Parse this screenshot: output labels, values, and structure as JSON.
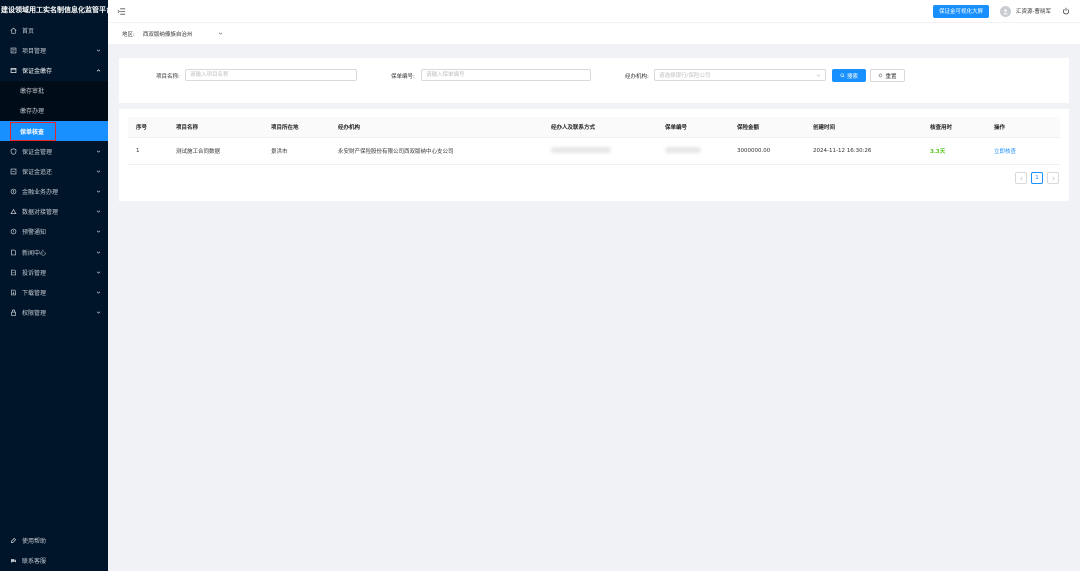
{
  "app": {
    "title": "建设领域用工实名制信息化监管平台"
  },
  "sidebar": {
    "items": [
      {
        "label": "首页",
        "icon": "home-icon"
      },
      {
        "label": "项目管理",
        "icon": "project-icon"
      },
      {
        "label": "保证金缴存",
        "icon": "deposit-icon",
        "open": true
      }
    ],
    "submenu": [
      {
        "label": "缴存审批"
      },
      {
        "label": "缴存办理"
      },
      {
        "label": "保单核查",
        "active": true
      }
    ],
    "items_after": [
      {
        "label": "保证金管理",
        "icon": "shield-icon"
      },
      {
        "label": "保证金追还",
        "icon": "return-icon"
      },
      {
        "label": "金融业务办理",
        "icon": "finance-icon"
      },
      {
        "label": "数据对接管理",
        "icon": "data-icon"
      },
      {
        "label": "预警通知",
        "icon": "alert-icon"
      },
      {
        "label": "新闻中心",
        "icon": "news-icon"
      },
      {
        "label": "投诉管理",
        "icon": "complaint-icon"
      },
      {
        "label": "下载管理",
        "icon": "download-icon"
      },
      {
        "label": "权限管理",
        "icon": "permission-icon"
      }
    ],
    "bottom": [
      {
        "label": "使用帮助",
        "icon": "help-icon"
      },
      {
        "label": "联系客服",
        "icon": "service-icon"
      }
    ]
  },
  "header": {
    "bigscreen_label": "保证金可视化大屏",
    "username": "汇资源-曹晓军"
  },
  "region": {
    "label": "地区:",
    "value": "西双版纳傣族自治州"
  },
  "search": {
    "project_label": "项目名称:",
    "project_placeholder": "请输入项目名称",
    "policy_label": "保单编号:",
    "policy_placeholder": "请输入保单编号",
    "org_label": "经办机构:",
    "org_placeholder": "请选择银行/保险公司",
    "search_label": "搜索",
    "reset_label": "重置"
  },
  "table": {
    "headers": [
      "序号",
      "项目名称",
      "项目所在地",
      "经办机构",
      "经办人及联系方式",
      "保单编号",
      "保险金额",
      "创建时间",
      "核查用时",
      "操作"
    ],
    "rows": [
      {
        "index": "1",
        "project": "测试施工合同数据",
        "location": "景洪市",
        "org": "永安财产保险股份有限公司西双版纳中心支公司",
        "amount": "3000000.00",
        "created": "2024-11-12 16:30:26",
        "duration": "3.3天",
        "action": "立即核查"
      }
    ]
  },
  "pagination": {
    "current": "1"
  },
  "colors": {
    "sidebar": "#001529",
    "accent": "#1890ff",
    "green": "#52c41a",
    "highlight": "#e8262a"
  }
}
